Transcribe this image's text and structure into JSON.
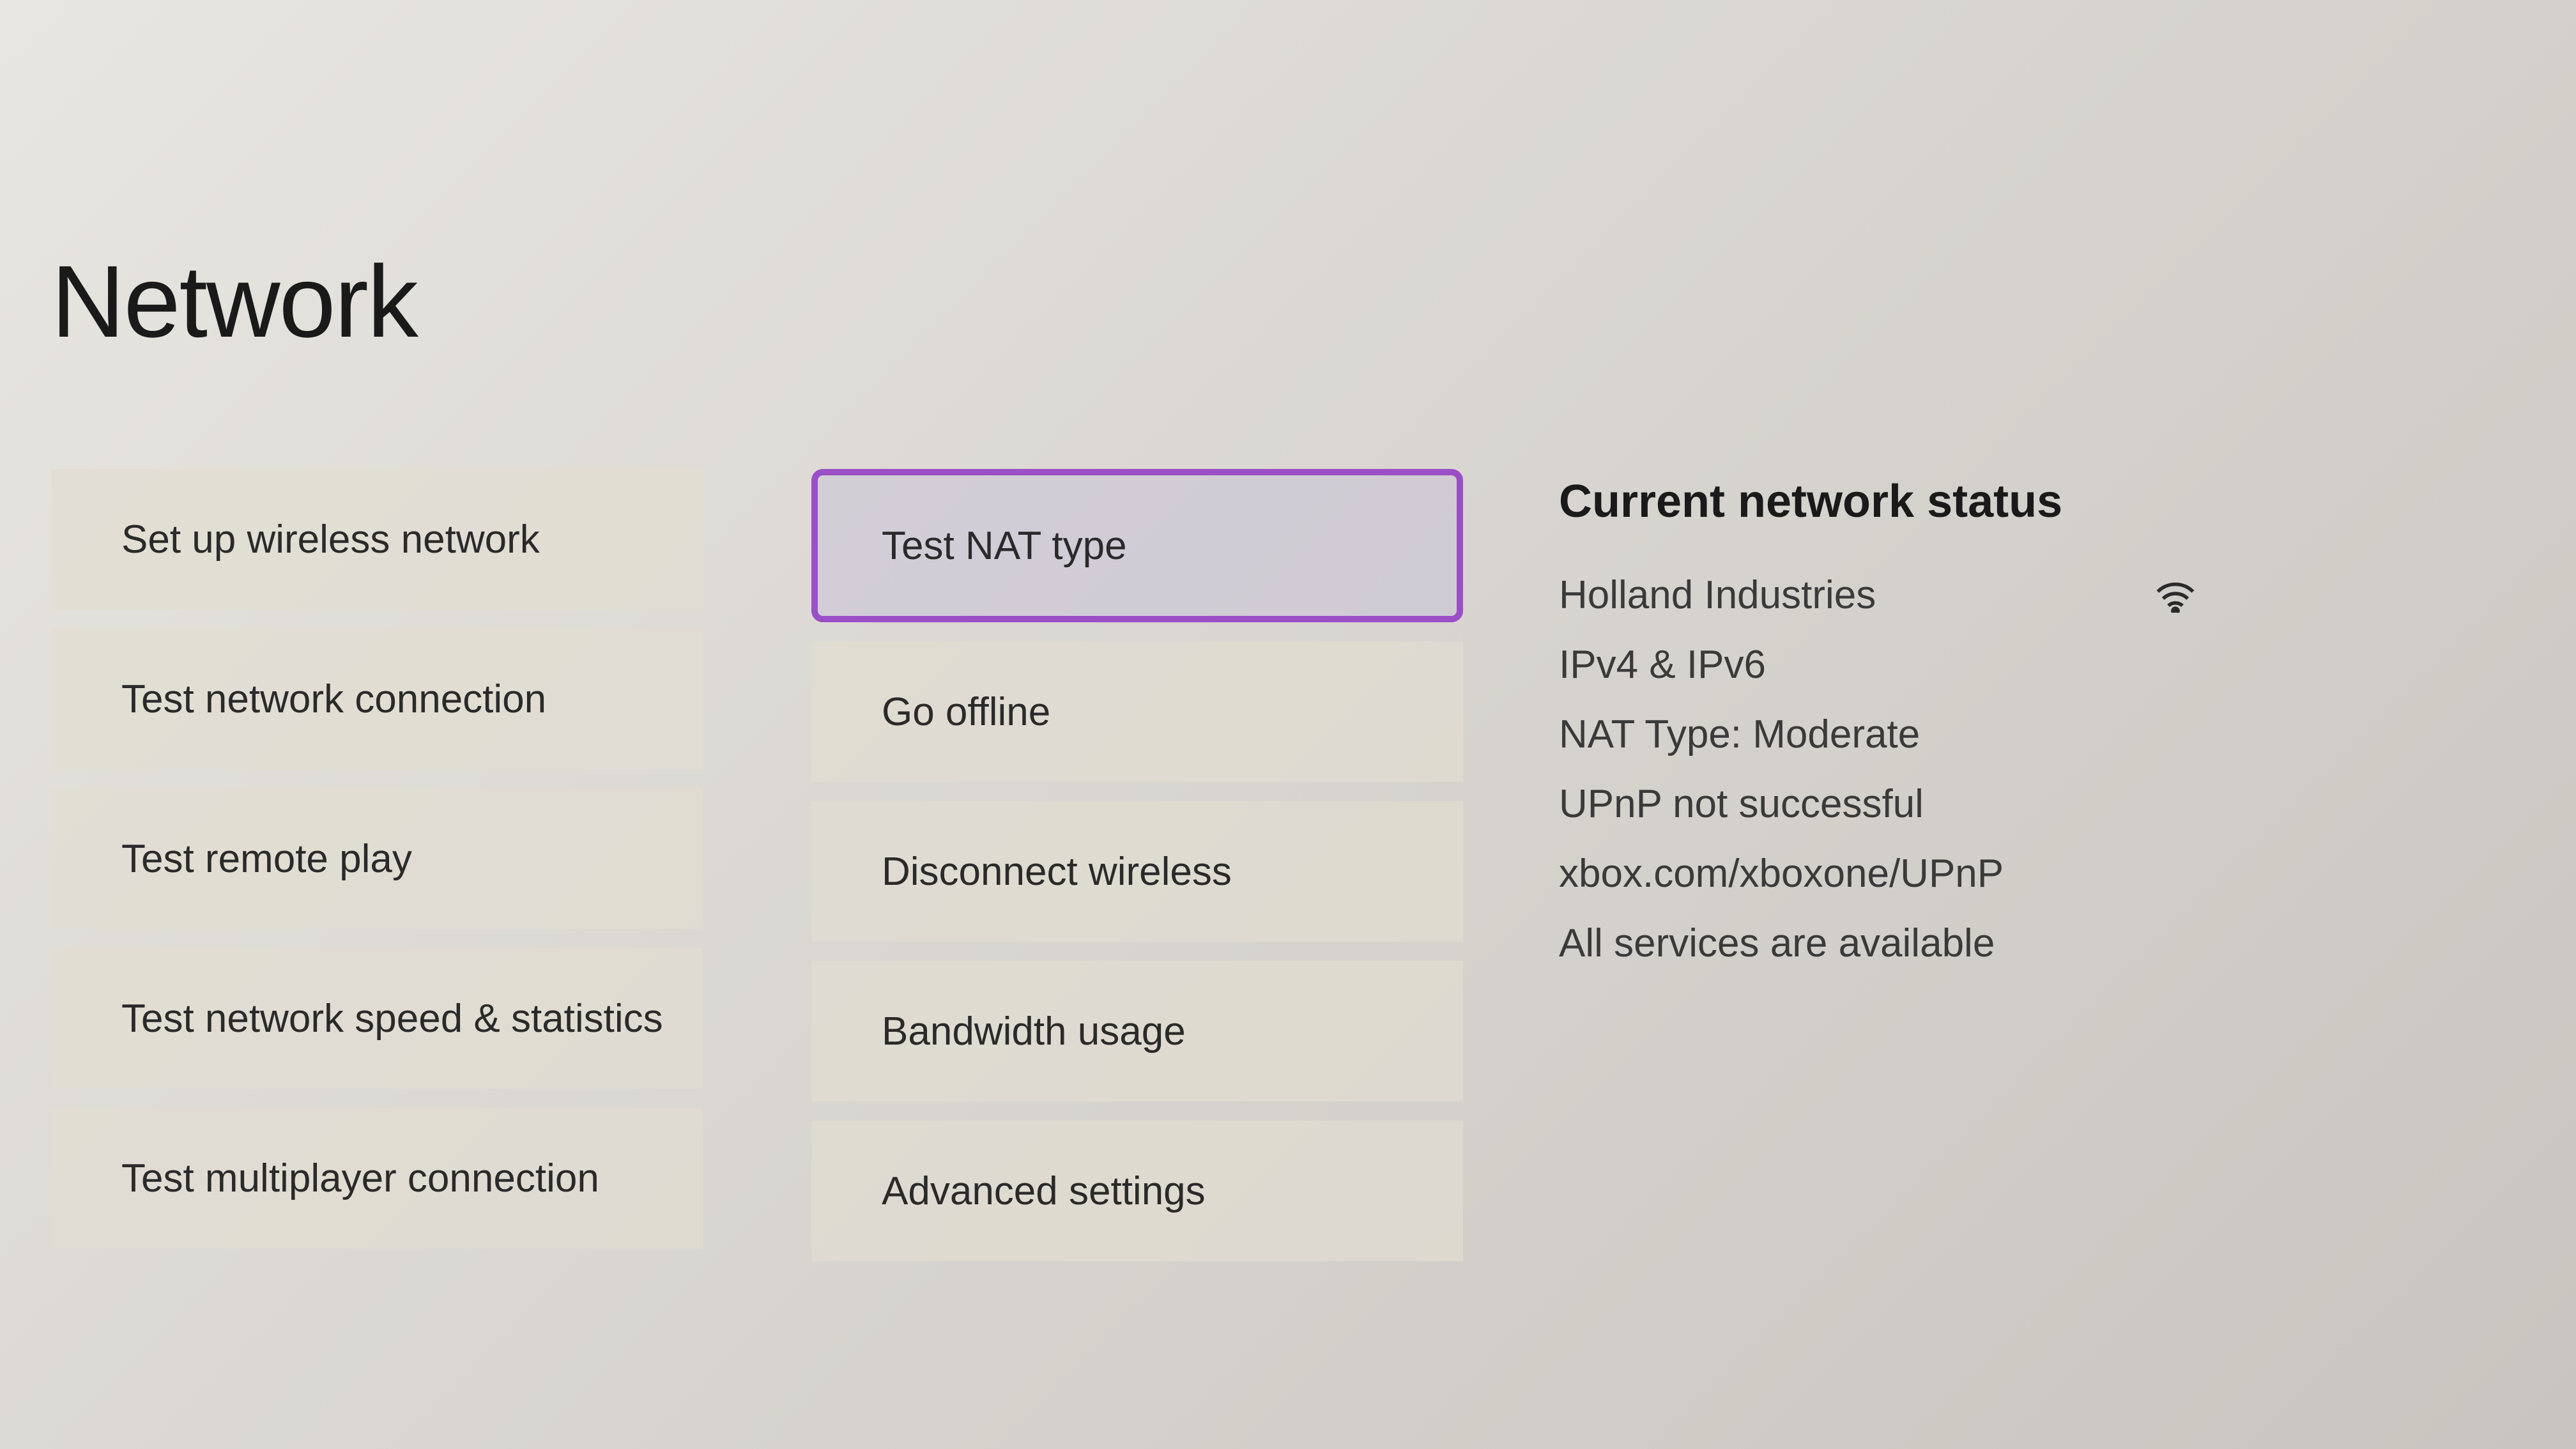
{
  "page": {
    "title": "Network"
  },
  "column1": {
    "items": [
      {
        "label": "Set up wireless network"
      },
      {
        "label": "Test network connection"
      },
      {
        "label": "Test remote play"
      },
      {
        "label": "Test network speed & statistics"
      },
      {
        "label": "Test multiplayer connection"
      }
    ]
  },
  "column2": {
    "items": [
      {
        "label": "Test NAT type",
        "selected": true
      },
      {
        "label": "Go offline"
      },
      {
        "label": "Disconnect wireless"
      },
      {
        "label": "Bandwidth usage"
      },
      {
        "label": "Advanced settings"
      }
    ]
  },
  "status": {
    "title": "Current network status",
    "ssid": "Holland Industries",
    "ip": "IPv4 & IPv6",
    "nat": "NAT Type: Moderate",
    "upnp": "UPnP not successful",
    "upnp_url": "xbox.com/xboxone/UPnP",
    "services": "All services are available"
  }
}
